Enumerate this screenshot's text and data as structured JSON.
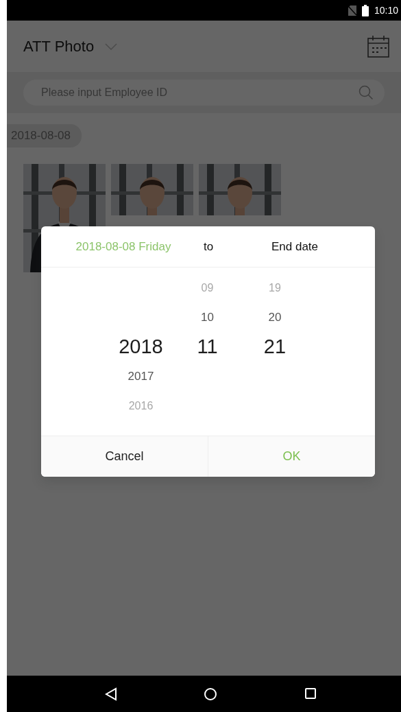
{
  "status_bar": {
    "time": "10:10"
  },
  "header": {
    "title": "ATT Photo"
  },
  "search": {
    "placeholder": "Please input Employee ID"
  },
  "groups": [
    {
      "date": "2018-08-08"
    }
  ],
  "dialog": {
    "start_date": "2018-08-08 Friday",
    "separator": "to",
    "end_date": "End date",
    "wheels": [
      {
        "items": [
          {
            "text": "2018",
            "selected": true
          },
          {
            "text": "2017",
            "selected": false
          },
          {
            "text": "2016",
            "selected": false
          }
        ]
      },
      {
        "items": [
          {
            "text": "09",
            "selected": false
          },
          {
            "text": "10",
            "selected": false
          },
          {
            "text": "11",
            "selected": true
          }
        ]
      },
      {
        "items": [
          {
            "text": "19",
            "selected": false
          },
          {
            "text": "20",
            "selected": false
          },
          {
            "text": "21",
            "selected": true
          }
        ]
      }
    ],
    "buttons": [
      {
        "label": "Cancel",
        "kind": "cancel"
      },
      {
        "label": "OK",
        "kind": "confirm"
      }
    ]
  }
}
